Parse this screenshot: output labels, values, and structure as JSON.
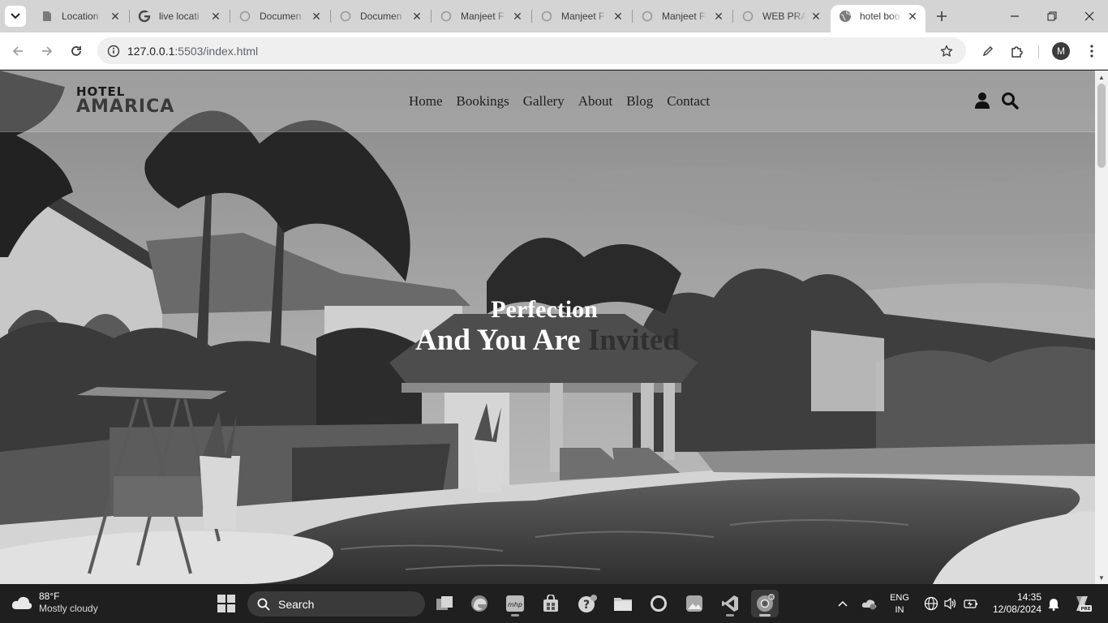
{
  "browser": {
    "tabs": [
      {
        "title": "Location",
        "icon": "document-favicon"
      },
      {
        "title": "live locati",
        "icon": "google-favicon"
      },
      {
        "title": "Documen",
        "icon": "loading-favicon"
      },
      {
        "title": "Documen",
        "icon": "loading-favicon"
      },
      {
        "title": "Manjeet F",
        "icon": "loading-favicon"
      },
      {
        "title": "Manjeet F",
        "icon": "loading-favicon"
      },
      {
        "title": "Manjeet F",
        "icon": "loading-favicon"
      },
      {
        "title": "WEB PRA",
        "icon": "loading-favicon"
      },
      {
        "title": "hotel boo",
        "icon": "globe-favicon",
        "active": true
      }
    ],
    "url_host": "127.0.0.1",
    "url_path": ":5503/index.html",
    "profile_initial": "M"
  },
  "site": {
    "brand_line1": "HOTEL",
    "brand_line2": "AMARICA",
    "nav": [
      "Home",
      "Bookings",
      "Gallery",
      "About",
      "Blog",
      "Contact"
    ],
    "hero_line1": "Perfection",
    "hero_line2_light": "And You Are ",
    "hero_line2_dark": "Invited"
  },
  "taskbar": {
    "weather_temp": "88°F",
    "weather_condition": "Mostly cloudy",
    "search_label": "Search",
    "lang_line1": "ENG",
    "lang_line2": "IN",
    "time": "14:35",
    "date": "12/08/2024",
    "copilot_badge": "PRE",
    "vscode_app_label": "mhp"
  }
}
